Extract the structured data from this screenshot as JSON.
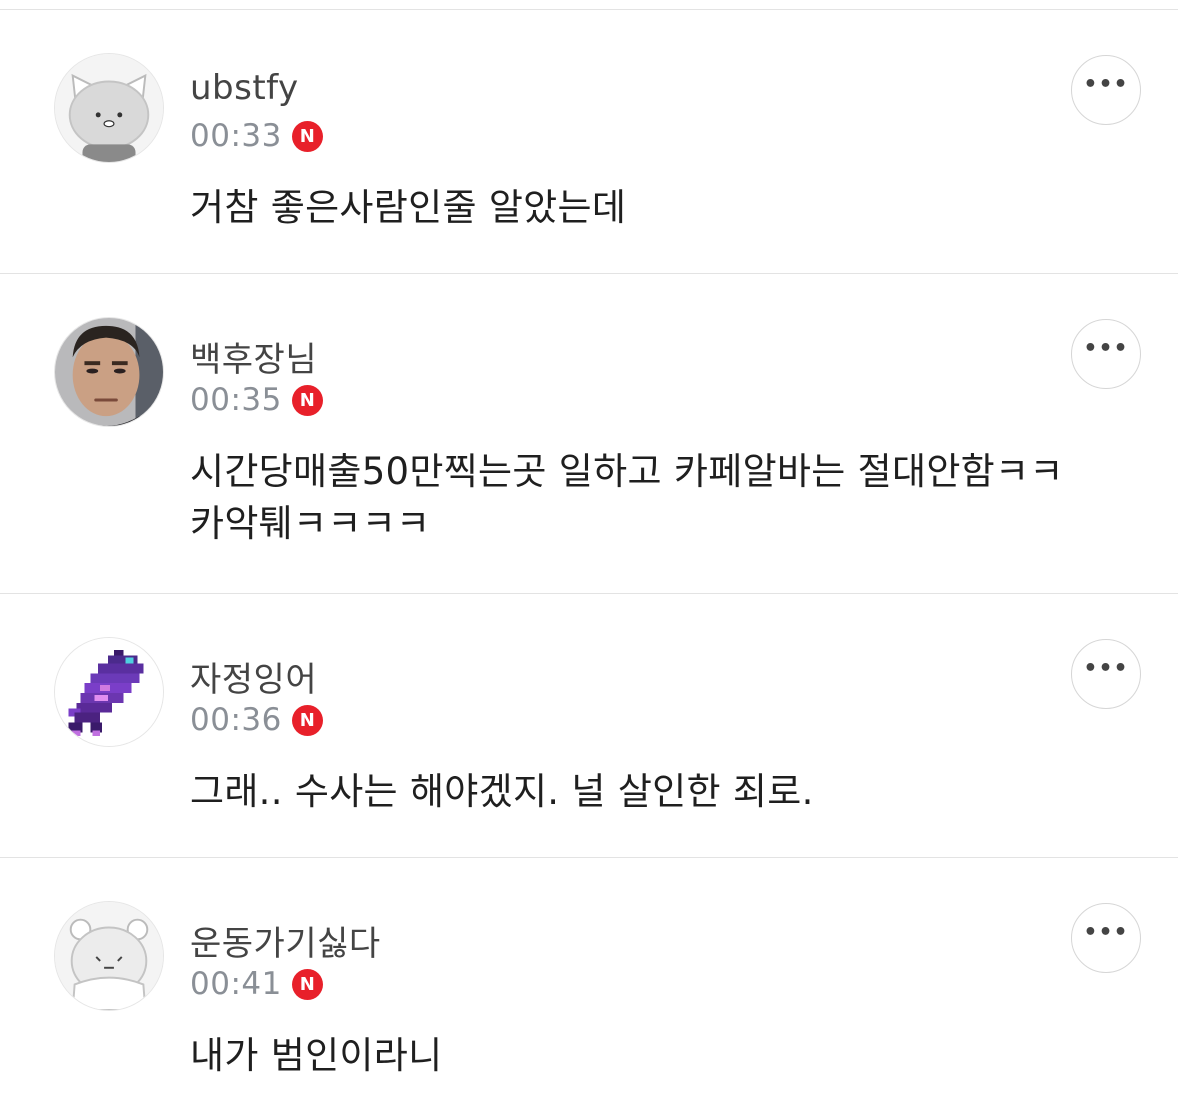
{
  "comments": [
    {
      "nickname": "ubstfy",
      "time": "00:33",
      "badge": "N",
      "text": "거참 좋은사람인줄 알았는데",
      "avatar": "cat-default-avatar",
      "more_label": "•••"
    },
    {
      "nickname": "백후장님",
      "time": "00:35",
      "badge": "N",
      "text": "시간당매출50만찍는곳 일하고 카페알바는 절대안함ㅋㅋ\n카악퉤ㅋㅋㅋㅋ",
      "avatar": "man-photo-avatar",
      "more_label": "•••"
    },
    {
      "nickname": "자정잉어",
      "time": "00:36",
      "badge": "N",
      "text": "그래.. 수사는 해야겠지. 널 살인한 죄로.",
      "avatar": "pixel-fish-avatar",
      "more_label": "•••"
    },
    {
      "nickname": "운동가기싫다",
      "time": "00:41",
      "badge": "N",
      "text": "내가 범인이라니",
      "avatar": "bear-default-avatar",
      "more_label": "•••"
    }
  ],
  "colors": {
    "badge": "#e8202a",
    "nickname": "#444444",
    "time": "#8a8f96",
    "divider": "#e3e3e3"
  }
}
